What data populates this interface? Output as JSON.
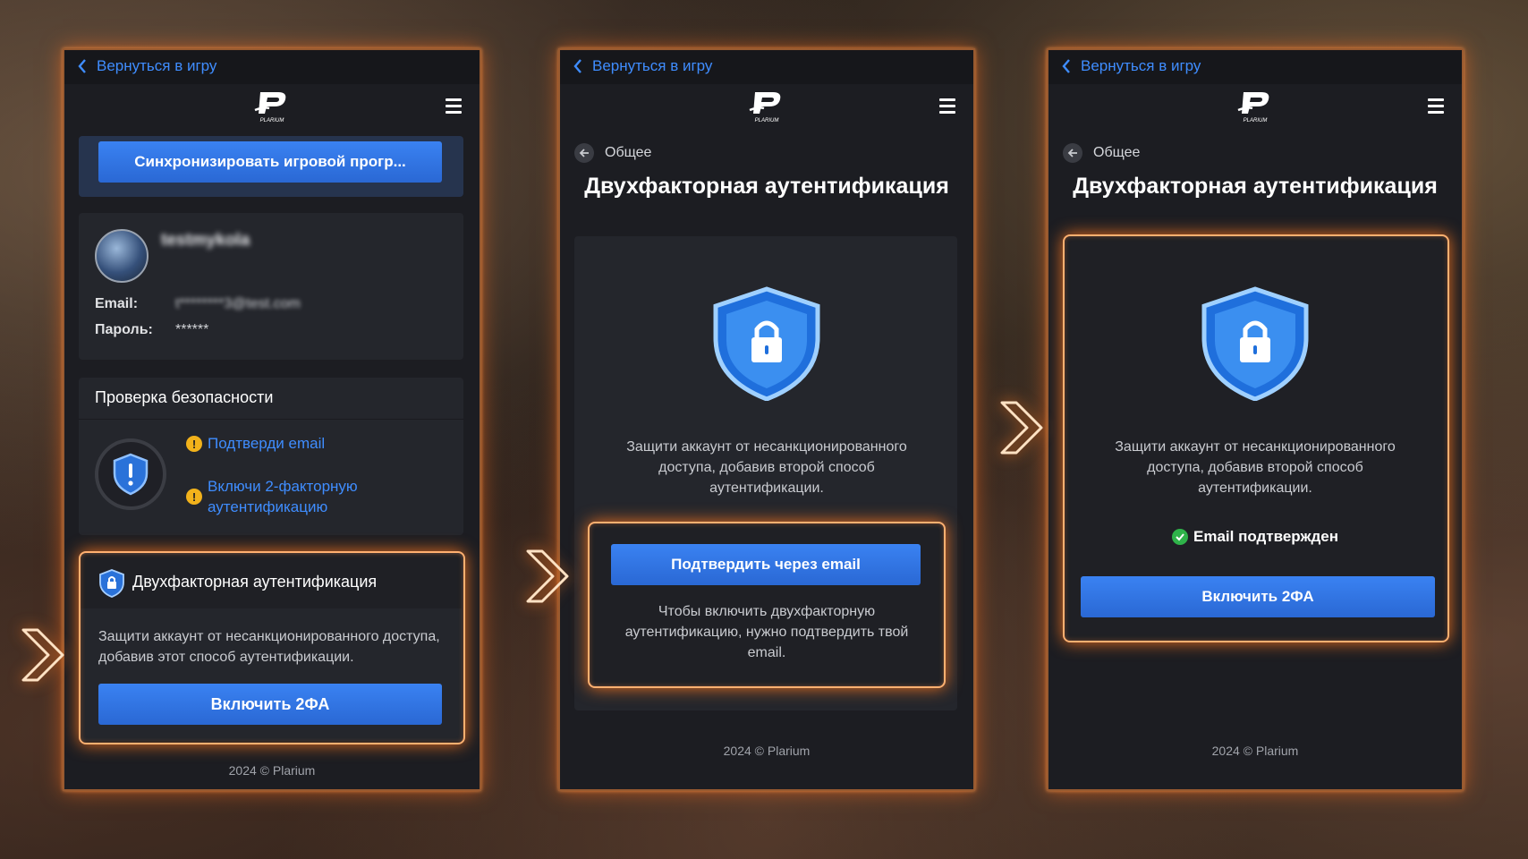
{
  "common": {
    "back_label": "Вернуться в игру",
    "logo_text": "PLARIUM",
    "footer": "2024 © Plarium",
    "accent_color": "#3f8dff",
    "glow_color": "#ff8a2a"
  },
  "panel1": {
    "sync_button": "Синхронизировать игровой прогр...",
    "profile": {
      "username": "testmykola",
      "email_label": "Email:",
      "email_value": "t********3@test.com",
      "password_label": "Пароль:",
      "password_value": "******"
    },
    "security": {
      "title": "Проверка безопасности",
      "item1": "Подтверди email",
      "item2": "Включи 2-факторную аутентификацию"
    },
    "twofa": {
      "title": "Двухфакторная аутентификация",
      "desc": "Защити аккаунт от несанкционированного доступа, добавив этот способ аутентификации.",
      "button": "Включить 2ФА"
    }
  },
  "panel2": {
    "breadcrumb": "Общее",
    "title": "Двухфакторная аутентификация",
    "desc": "Защити аккаунт от несанкционированного доступа, добавив второй способ аутентификации.",
    "button": "Подтвердить через email",
    "note": "Чтобы включить двухфакторную аутентификацию, нужно подтвердить твой email."
  },
  "panel3": {
    "breadcrumb": "Общее",
    "title": "Двухфакторная аутентификация",
    "desc": "Защити аккаунт от несанкционированного доступа, добавив второй способ аутентификации.",
    "status": "Email подтвержден",
    "button": "Включить 2ФА"
  }
}
